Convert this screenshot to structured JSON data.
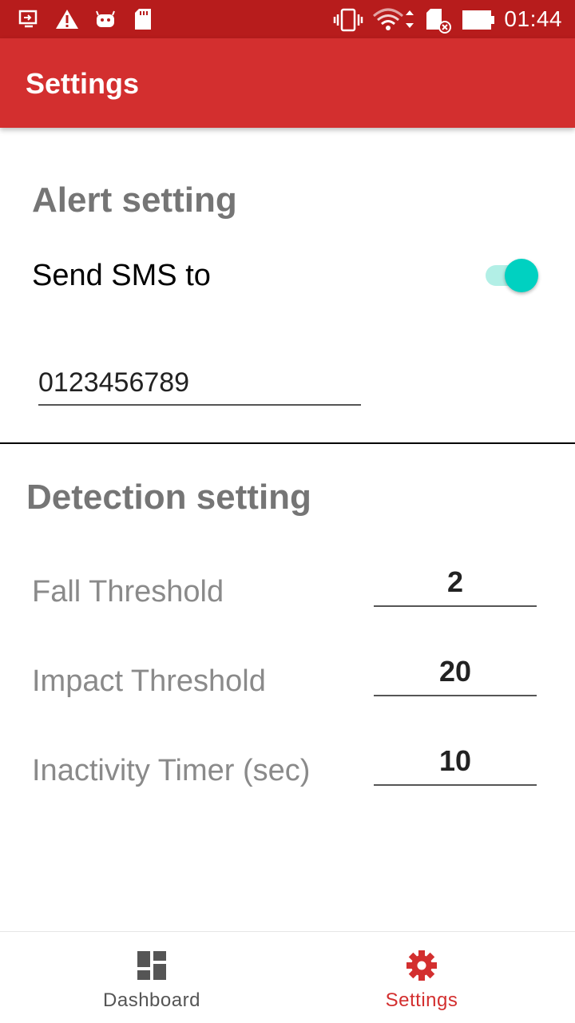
{
  "status_bar": {
    "time": "01:44",
    "icons": [
      "screen-cast-icon",
      "warning-icon",
      "android-icon",
      "sd-card-icon",
      "vibrate-icon",
      "wifi-icon",
      "sd-card-error-icon",
      "battery-icon"
    ]
  },
  "app_bar": {
    "title": "Settings"
  },
  "alert": {
    "heading": "Alert setting",
    "sms_label": "Send SMS to",
    "sms_enabled": true,
    "phone_number": "0123456789"
  },
  "detection": {
    "heading": "Detection setting",
    "params": [
      {
        "label": "Fall Threshold",
        "value": "2"
      },
      {
        "label": "Impact Threshold",
        "value": "20"
      },
      {
        "label": "Inactivity Timer (sec)",
        "value": "10"
      }
    ]
  },
  "bottom_nav": {
    "items": [
      {
        "label": "Dashboard",
        "icon": "dashboard-icon",
        "selected": false
      },
      {
        "label": "Settings",
        "icon": "gear-icon",
        "selected": true
      }
    ]
  },
  "colors": {
    "status_bar": "#b71c1c",
    "app_bar": "#d32f2f",
    "accent": "#00d1c1",
    "nav_selected": "#d32f2f",
    "nav_unselected": "#555555"
  }
}
